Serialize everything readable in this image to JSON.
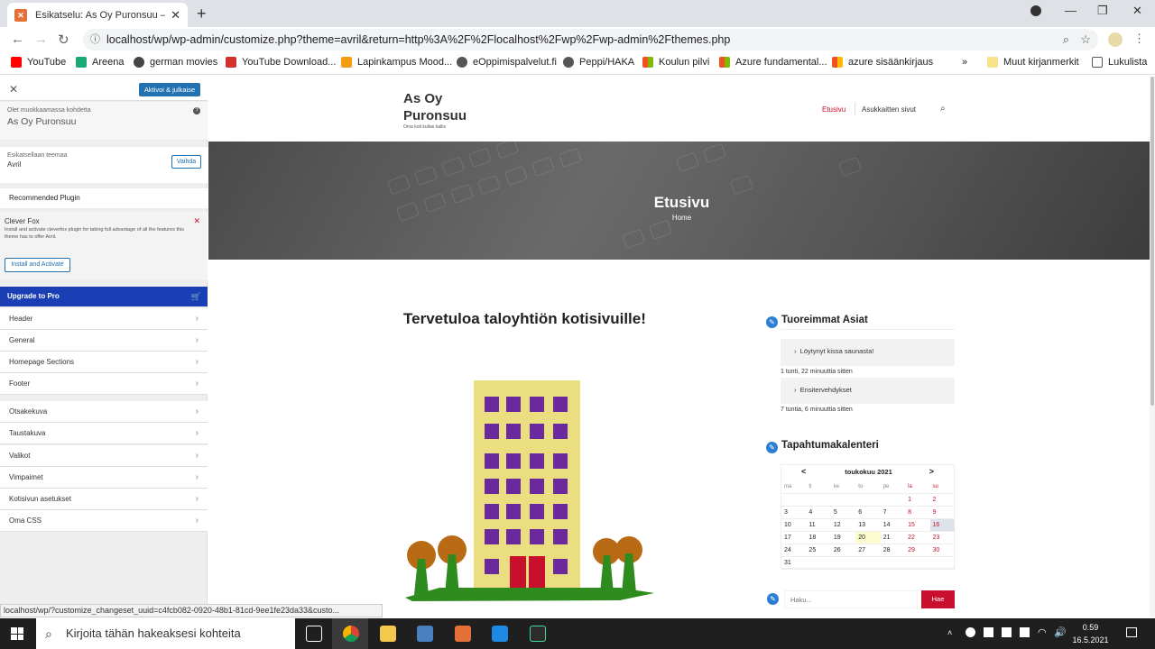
{
  "browser": {
    "tab_title": "Esikatselu: As Oy Puronsuu – Om",
    "url": "localhost/wp/wp-admin/customize.php?theme=avril&return=http%3A%2F%2Flocalhost%2Fwp%2Fwp-admin%2Fthemes.php",
    "bookmarks": [
      "YouTube",
      "Areena",
      "german movies",
      "YouTube Download...",
      "Lapinkampus Mood...",
      "eOppimispalvelut.fi",
      "Peppi/HAKA",
      "Koulun pilvi",
      "Azure fundamental...",
      "azure sisäänkirjaus"
    ],
    "other_bookmarks": "Muut kirjanmerkit",
    "reading_list": "Lukulista",
    "more": "»"
  },
  "customizer": {
    "publish_button": "Aktivoi & julkaise",
    "editing_label": "Olet muokkaamassa kohdetta",
    "editing_site": "As Oy Puronsuu",
    "preview_theme_label": "Esikatsellaan teemaa",
    "theme_name": "Avril",
    "change_button": "Vaihda",
    "recommended_plugin": "Recommended Plugin",
    "plugin_name": "Clever Fox",
    "plugin_desc": "Install and activate cleverfox plugin for taking full advantage of all the features this theme has to offer Avril.",
    "install_button": "Install and Activate",
    "upgrade": "Upgrade to Pro",
    "sections_a": [
      "Header",
      "General",
      "Homepage Sections",
      "Footer"
    ],
    "sections_b": [
      "Otsakekuva",
      "Taustakuva",
      "Valikot",
      "Vimpaimet",
      "Kotisivun asetukset",
      "Oma CSS"
    ]
  },
  "site": {
    "title_line1": "As Oy",
    "title_line2": "Puronsuu",
    "tagline": "Oma koti kullan kallis",
    "nav_home": "Etusivu",
    "nav_residents": "Asukkaitten sivut",
    "hero_title": "Etusivu",
    "hero_breadcrumb": "Home",
    "welcome": "Tervetuloa taloyhtiön kotisivuille!"
  },
  "sidebar": {
    "recent_title": "Tuoreimmat Asiat",
    "recent": [
      {
        "title": "Löytynyt kissa saunasta!",
        "time": "1 tunti, 22 minuuttia sitten"
      },
      {
        "title": "Ensitervehdykset",
        "time": "7 tuntia, 6 minuuttia sitten"
      }
    ],
    "calendar_title": "Tapahtumakalenteri",
    "calendar_month": "toukokuu 2021",
    "calendar_prev": "<",
    "calendar_next": ">",
    "weekdays": [
      "ma",
      "ti",
      "ke",
      "to",
      "pe",
      "la",
      "su"
    ],
    "weeks": [
      [
        "",
        "",
        "",
        "",
        "",
        "1",
        "2"
      ],
      [
        "3",
        "4",
        "5",
        "6",
        "7",
        "8",
        "9"
      ],
      [
        "10",
        "11",
        "12",
        "13",
        "14",
        "15",
        "16"
      ],
      [
        "17",
        "18",
        "19",
        "20",
        "21",
        "22",
        "23"
      ],
      [
        "24",
        "25",
        "26",
        "27",
        "28",
        "29",
        "30"
      ],
      [
        "31",
        "",
        "",
        "",
        "",
        "",
        ""
      ]
    ],
    "search_placeholder": "Haku...",
    "search_button": "Hae"
  },
  "statusbar": "localhost/wp/?customize_changeset_uuid=c4fcb082-0920-48b1-81cd-9ee1fe23da33&custo...",
  "taskbar": {
    "search_placeholder": "Kirjoita tähän hakeaksesi kohteita",
    "time": "0.59",
    "date": "16.5.2021"
  },
  "colors": {
    "accent_red": "#c8102e",
    "wp_blue": "#2271b1",
    "upgrade_blue": "#1a3fb5"
  }
}
